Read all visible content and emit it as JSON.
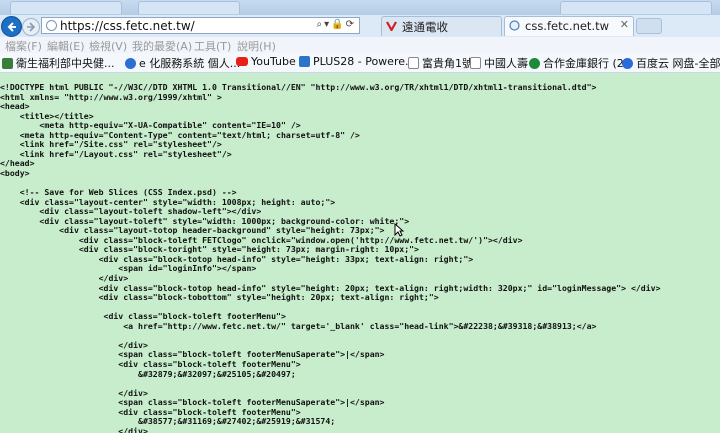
{
  "browser": {
    "address": {
      "url": "https://css.fetc.net.tw/"
    },
    "tabs": [
      {
        "label": "遠通電收",
        "icon": "vee-favicon-icon",
        "active": false
      },
      {
        "label": "css.fetc.net.tw",
        "icon": "page-icon",
        "active": true
      }
    ],
    "menu": [
      "檔案(F)",
      "編輯(E)",
      "檢視(V)",
      "我的最愛(A)",
      "工具(T)",
      "說明(H)"
    ],
    "favorites": [
      {
        "label": "衛生福利部中央健...",
        "icon": "site-icon",
        "color": "#3a7d3a"
      },
      {
        "label": "e 化服務系統 個人...",
        "icon": "ie-icon",
        "color": "#2a6fd1"
      },
      {
        "label": "YouTube",
        "icon": "youtube-icon",
        "color": "#e62117"
      },
      {
        "label": "PLUS28 - Powere...",
        "icon": "plus-icon",
        "color": "#2c74c8"
      },
      {
        "label": "富貴角1號",
        "icon": "page-icon",
        "color": "#888888"
      },
      {
        "label": "中國人壽",
        "icon": "page-icon",
        "color": "#888888"
      },
      {
        "label": "合作金庫銀行 (2)",
        "icon": "bank-icon",
        "color": "#1d8a3a"
      },
      {
        "label": "百度云 网盘-全部...",
        "icon": "baidu-icon",
        "color": "#2b6bd8"
      }
    ]
  },
  "source_lines": [
    "<!DOCTYPE html PUBLIC \"-//W3C//DTD XHTML 1.0 Transitional//EN\" \"http://www.w3.org/TR/xhtml1/DTD/xhtml1-transitional.dtd\">",
    "<html xmlns= \"http://www.w3.org/1999/xhtml\" >",
    "<head>",
    "    <title></title>",
    "        <meta http-equiv=\"X-UA-Compatible\" content=\"IE=10\" />",
    "    <meta http-equiv=\"Content-Type\" content=\"text/html; charset=utf-8\" />",
    "    <link href=\"/Site.css\" rel=\"stylesheet\"/>",
    "    <link href=\"/Layout.css\" rel=\"stylesheet\"/>",
    "</head>",
    "<body>",
    "",
    "    <!-- Save for Web Slices (CSS Index.psd) -->",
    "    <div class=\"layout-center\" style=\"width: 1008px; height: auto;\">",
    "        <div class=\"layout-toleft shadow-left\"></div>",
    "        <div class=\"layout-toleft\" style=\"width: 1000px; background-color: white;\">",
    "            <div class=\"layout-totop header-background\" style=\"height: 73px;\">",
    "                <div class=\"block-toleft FETClogo\" onclick=\"window.open('http://www.fetc.net.tw/')\"></div>",
    "                <div class=\"block-toright\" style=\"height: 73px; margin-right: 10px;\">",
    "                    <div class=\"block-totop head-info\" style=\"height: 33px; text-align: right;\">",
    "                        <span id=\"loginInfo\"></span>",
    "                    </div>",
    "                    <div class=\"block-totop head-info\" style=\"height: 20px; text-align: right;width: 320px;\" id=\"loginMessage\"> </div>",
    "                    <div class=\"block-tobottom\" style=\"height: 20px; text-align: right;\">",
    "",
    "                     <div class=\"block-toleft footerMenu\">",
    "                         <a href=\"http://www.fetc.net.tw/\" target='_blank' class=\"head-link\">&#22238;&#39318;&#38913;</a>",
    "",
    "                        </div>",
    "                        <span class=\"block-toleft footerMenuSaperate\">|</span>",
    "                        <div class=\"block-toleft footerMenu\">",
    "                            &#32879;&#32097;&#25105;&#20497;",
    "",
    "                        </div>",
    "                        <span class=\"block-toleft footerMenuSaperate\">|</span>",
    "                        <div class=\"block-toleft footerMenu\">",
    "                            &#38577;&#31169;&#27402;&#25919;&#31574;",
    "                        </div>"
  ]
}
